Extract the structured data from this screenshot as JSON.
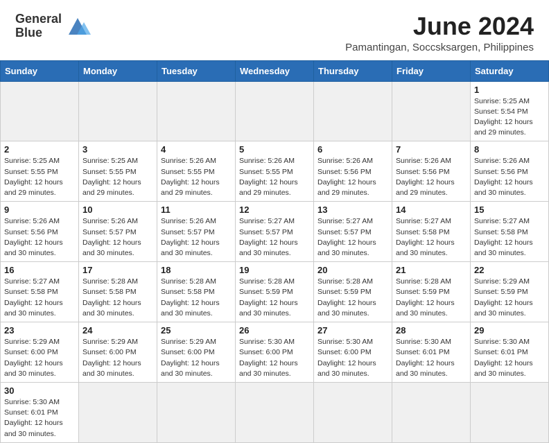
{
  "logo": {
    "text_general": "General",
    "text_blue": "Blue"
  },
  "title": "June 2024",
  "subtitle": "Pamantingan, Soccsksargen, Philippines",
  "days_of_week": [
    "Sunday",
    "Monday",
    "Tuesday",
    "Wednesday",
    "Thursday",
    "Friday",
    "Saturday"
  ],
  "weeks": [
    [
      {
        "day": "",
        "empty": true
      },
      {
        "day": "",
        "empty": true
      },
      {
        "day": "",
        "empty": true
      },
      {
        "day": "",
        "empty": true
      },
      {
        "day": "",
        "empty": true
      },
      {
        "day": "",
        "empty": true
      },
      {
        "day": "1",
        "info": "Sunrise: 5:25 AM\nSunset: 5:54 PM\nDaylight: 12 hours and 29 minutes."
      }
    ],
    [
      {
        "day": "2",
        "info": "Sunrise: 5:25 AM\nSunset: 5:55 PM\nDaylight: 12 hours and 29 minutes."
      },
      {
        "day": "3",
        "info": "Sunrise: 5:25 AM\nSunset: 5:55 PM\nDaylight: 12 hours and 29 minutes."
      },
      {
        "day": "4",
        "info": "Sunrise: 5:26 AM\nSunset: 5:55 PM\nDaylight: 12 hours and 29 minutes."
      },
      {
        "day": "5",
        "info": "Sunrise: 5:26 AM\nSunset: 5:55 PM\nDaylight: 12 hours and 29 minutes."
      },
      {
        "day": "6",
        "info": "Sunrise: 5:26 AM\nSunset: 5:56 PM\nDaylight: 12 hours and 29 minutes."
      },
      {
        "day": "7",
        "info": "Sunrise: 5:26 AM\nSunset: 5:56 PM\nDaylight: 12 hours and 29 minutes."
      },
      {
        "day": "8",
        "info": "Sunrise: 5:26 AM\nSunset: 5:56 PM\nDaylight: 12 hours and 30 minutes."
      }
    ],
    [
      {
        "day": "9",
        "info": "Sunrise: 5:26 AM\nSunset: 5:56 PM\nDaylight: 12 hours and 30 minutes."
      },
      {
        "day": "10",
        "info": "Sunrise: 5:26 AM\nSunset: 5:57 PM\nDaylight: 12 hours and 30 minutes."
      },
      {
        "day": "11",
        "info": "Sunrise: 5:26 AM\nSunset: 5:57 PM\nDaylight: 12 hours and 30 minutes."
      },
      {
        "day": "12",
        "info": "Sunrise: 5:27 AM\nSunset: 5:57 PM\nDaylight: 12 hours and 30 minutes."
      },
      {
        "day": "13",
        "info": "Sunrise: 5:27 AM\nSunset: 5:57 PM\nDaylight: 12 hours and 30 minutes."
      },
      {
        "day": "14",
        "info": "Sunrise: 5:27 AM\nSunset: 5:58 PM\nDaylight: 12 hours and 30 minutes."
      },
      {
        "day": "15",
        "info": "Sunrise: 5:27 AM\nSunset: 5:58 PM\nDaylight: 12 hours and 30 minutes."
      }
    ],
    [
      {
        "day": "16",
        "info": "Sunrise: 5:27 AM\nSunset: 5:58 PM\nDaylight: 12 hours and 30 minutes."
      },
      {
        "day": "17",
        "info": "Sunrise: 5:28 AM\nSunset: 5:58 PM\nDaylight: 12 hours and 30 minutes."
      },
      {
        "day": "18",
        "info": "Sunrise: 5:28 AM\nSunset: 5:58 PM\nDaylight: 12 hours and 30 minutes."
      },
      {
        "day": "19",
        "info": "Sunrise: 5:28 AM\nSunset: 5:59 PM\nDaylight: 12 hours and 30 minutes."
      },
      {
        "day": "20",
        "info": "Sunrise: 5:28 AM\nSunset: 5:59 PM\nDaylight: 12 hours and 30 minutes."
      },
      {
        "day": "21",
        "info": "Sunrise: 5:28 AM\nSunset: 5:59 PM\nDaylight: 12 hours and 30 minutes."
      },
      {
        "day": "22",
        "info": "Sunrise: 5:29 AM\nSunset: 5:59 PM\nDaylight: 12 hours and 30 minutes."
      }
    ],
    [
      {
        "day": "23",
        "info": "Sunrise: 5:29 AM\nSunset: 6:00 PM\nDaylight: 12 hours and 30 minutes."
      },
      {
        "day": "24",
        "info": "Sunrise: 5:29 AM\nSunset: 6:00 PM\nDaylight: 12 hours and 30 minutes."
      },
      {
        "day": "25",
        "info": "Sunrise: 5:29 AM\nSunset: 6:00 PM\nDaylight: 12 hours and 30 minutes."
      },
      {
        "day": "26",
        "info": "Sunrise: 5:30 AM\nSunset: 6:00 PM\nDaylight: 12 hours and 30 minutes."
      },
      {
        "day": "27",
        "info": "Sunrise: 5:30 AM\nSunset: 6:00 PM\nDaylight: 12 hours and 30 minutes."
      },
      {
        "day": "28",
        "info": "Sunrise: 5:30 AM\nSunset: 6:01 PM\nDaylight: 12 hours and 30 minutes."
      },
      {
        "day": "29",
        "info": "Sunrise: 5:30 AM\nSunset: 6:01 PM\nDaylight: 12 hours and 30 minutes."
      }
    ],
    [
      {
        "day": "30",
        "info": "Sunrise: 5:30 AM\nSunset: 6:01 PM\nDaylight: 12 hours and 30 minutes."
      },
      {
        "day": "",
        "empty": true
      },
      {
        "day": "",
        "empty": true
      },
      {
        "day": "",
        "empty": true
      },
      {
        "day": "",
        "empty": true
      },
      {
        "day": "",
        "empty": true
      },
      {
        "day": "",
        "empty": true
      }
    ]
  ]
}
